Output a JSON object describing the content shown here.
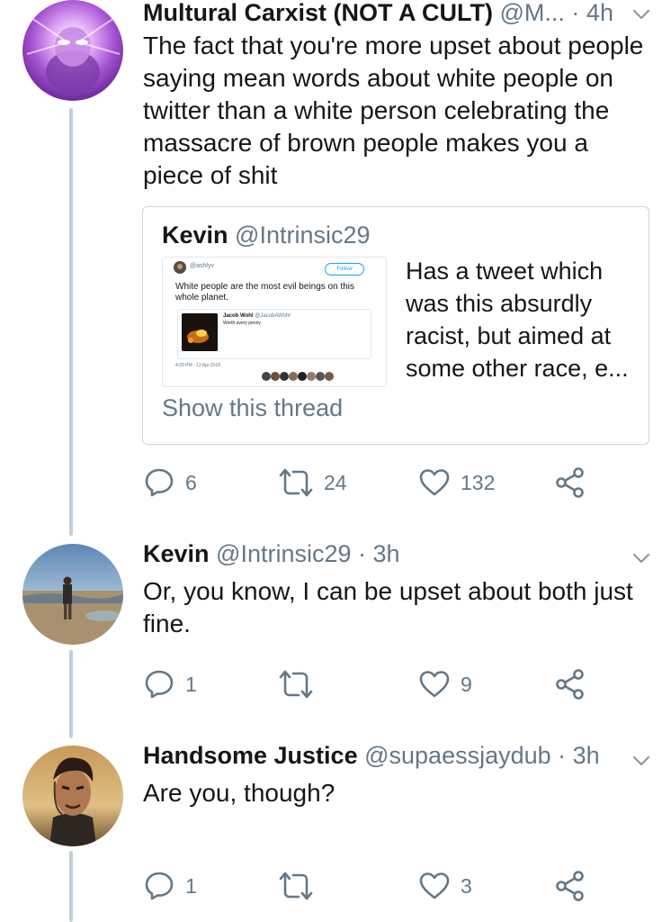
{
  "tweets": [
    {
      "name": "Multural Carxist (NOT A CULT)",
      "handle": "@M...",
      "dot": " · ",
      "time": "4h",
      "text_lines": [
        "The fact that you're more upset about people",
        "saying mean words about white people on",
        "twitter than a white person celebrating the",
        "massacre of brown people makes you a",
        "piece of shit"
      ],
      "quote": {
        "name": "Kevin",
        "handle": "@Intrinsic29",
        "text_lines": [
          "Has a tweet which",
          "was this absurdly",
          "racist, but aimed at",
          "some other race, e..."
        ],
        "show_thread": "Show this thread",
        "image": {
          "user": "@ashlyv",
          "follow": "Follow",
          "text": "White people are the most evil beings on this whole planet.",
          "quoted_name": "Jacob Wohl",
          "quoted_handle": "@JacobAWohl",
          "quoted_text": "Worth every penny",
          "date": "4:29 PM - 13 Apr 2018"
        }
      },
      "replies": "6",
      "retweets": "24",
      "likes": "132"
    },
    {
      "name": "Kevin",
      "handle": "@Intrinsic29",
      "dot": " · ",
      "time": "3h",
      "text_lines": [
        "Or, you know, I can be upset about both just",
        "fine."
      ],
      "replies": "1",
      "retweets": "",
      "likes": "9"
    },
    {
      "name": "Handsome Justice",
      "handle": "@supaessjaydub",
      "dot": " · ",
      "time": "3h",
      "text_lines": [
        "Are you, though?"
      ],
      "replies": "1",
      "retweets": "",
      "likes": "3"
    }
  ],
  "icons": {
    "reply": "reply-icon",
    "retweet": "retweet-icon",
    "like": "heart-icon",
    "share": "share-icon",
    "more": "chevron-down-icon"
  },
  "colors": {
    "text": "#14171a",
    "muted": "#657786",
    "border": "#ccd6dd",
    "thread_line": "#c4cfd6",
    "link": "#1da1f2"
  }
}
